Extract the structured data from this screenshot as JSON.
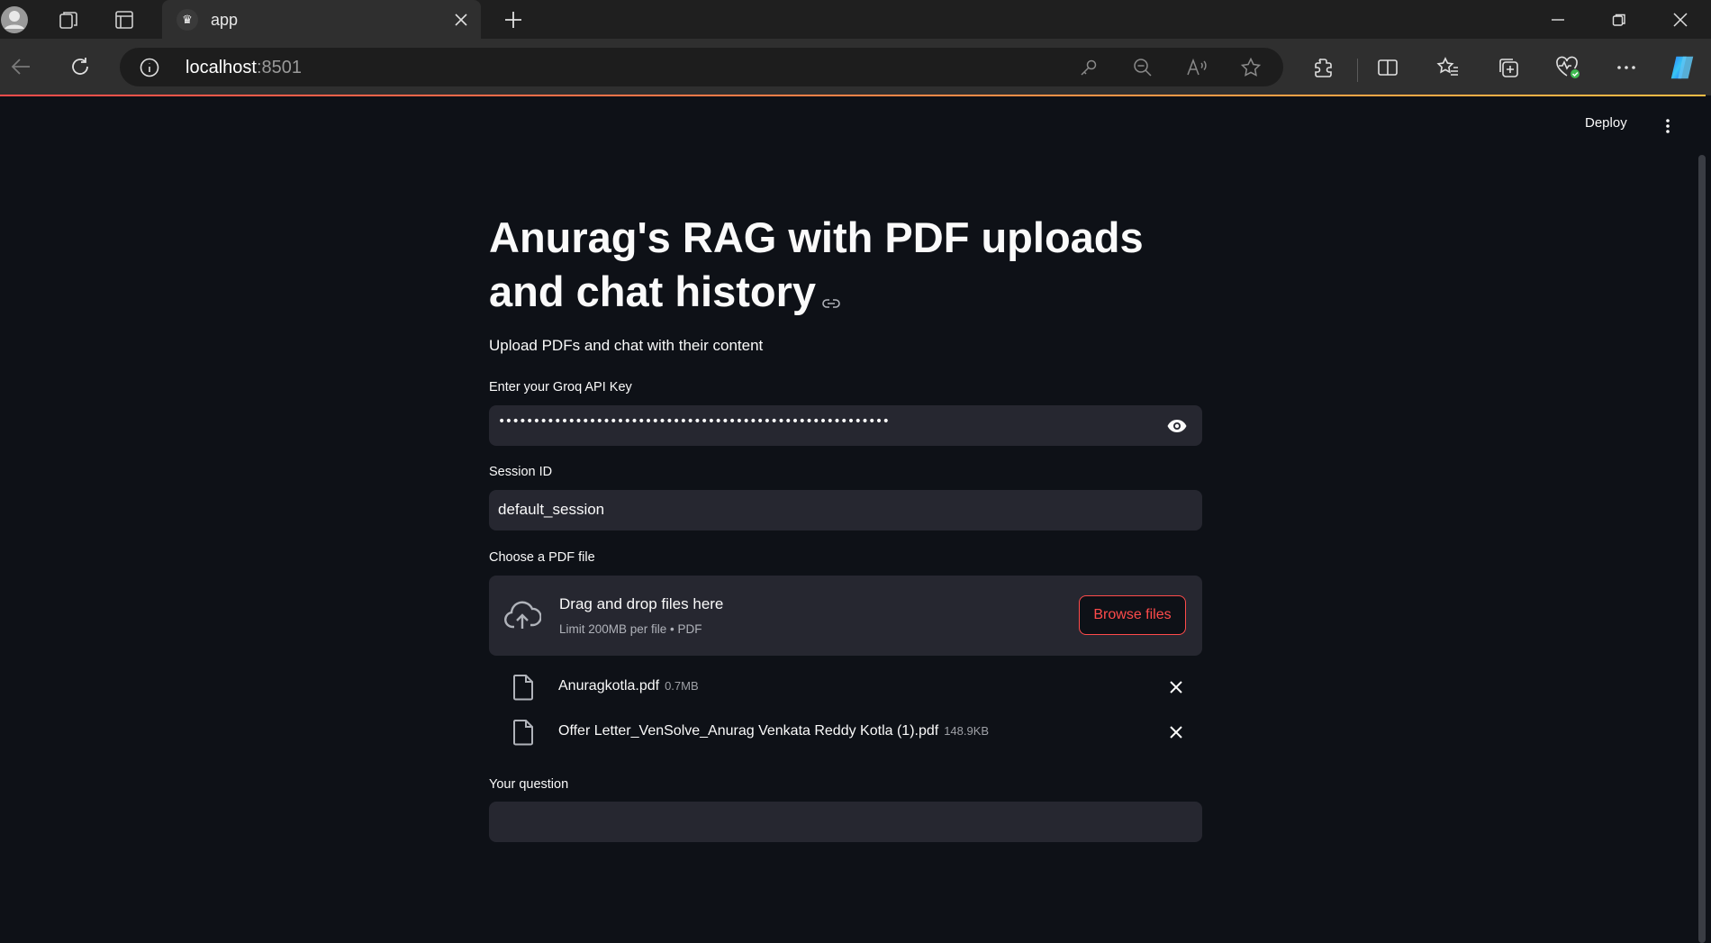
{
  "browser": {
    "tab_title": "app",
    "url_host": "localhost",
    "url_port": ":8501"
  },
  "app": {
    "deploy_label": "Deploy",
    "title": "Anurag's RAG with PDF uploads and chat history",
    "subtitle": "Upload PDFs and chat with their content",
    "api_key": {
      "label": "Enter your Groq API Key",
      "masked_value": "••••••••••••••••••••••••••••••••••••••••••••••••••••••••"
    },
    "session": {
      "label": "Session ID",
      "value": "default_session"
    },
    "uploader": {
      "label": "Choose a PDF file",
      "drop_text": "Drag and drop files here",
      "limit_text": "Limit 200MB per file • PDF",
      "browse_label": "Browse files",
      "files": [
        {
          "name": "Anuragkotla.pdf",
          "size": "0.7MB"
        },
        {
          "name": "Offer Letter_VenSolve_Anurag Venkata Reddy Kotla (1).pdf",
          "size": "148.9KB"
        }
      ]
    },
    "question": {
      "label": "Your question",
      "value": ""
    }
  },
  "colors": {
    "background": "#0e1117",
    "input_bg": "#262730",
    "accent": "#ff4b4b"
  },
  "icons": [
    "profile-icon",
    "workspaces-icon",
    "tab-actions-icon",
    "back-icon",
    "refresh-icon",
    "info-icon",
    "key-icon",
    "zoom-out-icon",
    "read-aloud-icon",
    "favorite-star-icon",
    "extensions-icon",
    "split-screen-icon",
    "favorites-icon",
    "collections-icon",
    "browser-essentials-icon",
    "more-icon",
    "copilot-icon",
    "eye-icon",
    "cloud-upload-icon",
    "file-icon",
    "close-icon",
    "link-icon",
    "kebab-menu-icon"
  ]
}
